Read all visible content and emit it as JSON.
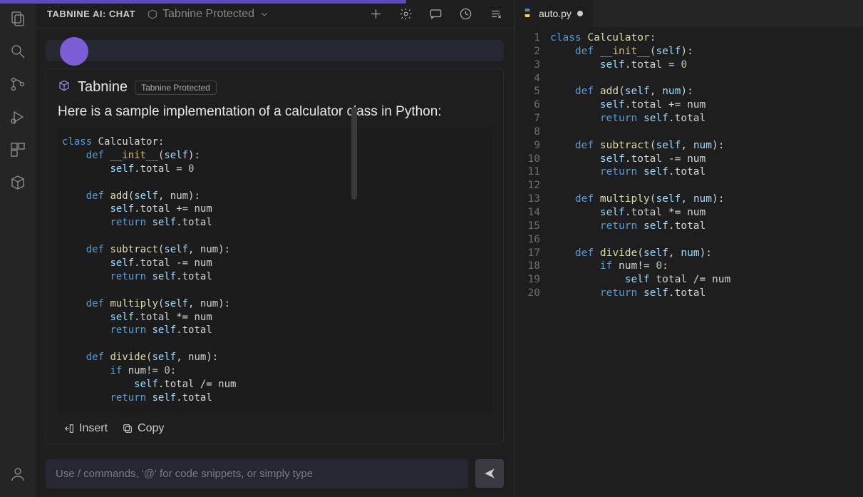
{
  "chat": {
    "title": "TABNINE AI: CHAT",
    "protected_label": "Tabnine Protected",
    "brand": "Tabnine",
    "badge": "Tabnine Protected",
    "intro": "Here is a sample implementation of a calculator class in Python:",
    "code": {
      "lines": [
        [
          {
            "t": "kw",
            "v": "class"
          },
          {
            "t": "",
            "v": " Calculator:"
          }
        ],
        [
          {
            "t": "",
            "v": "    "
          },
          {
            "t": "kw",
            "v": "def"
          },
          {
            "t": "",
            "v": " "
          },
          {
            "t": "magic",
            "v": "__init__"
          },
          {
            "t": "",
            "v": "("
          },
          {
            "t": "self",
            "v": "self"
          },
          {
            "t": "",
            "v": "):"
          }
        ],
        [
          {
            "t": "",
            "v": "        "
          },
          {
            "t": "self",
            "v": "self"
          },
          {
            "t": "",
            "v": ".total = "
          },
          {
            "t": "num",
            "v": "0"
          }
        ],
        [
          {
            "t": "",
            "v": ""
          }
        ],
        [
          {
            "t": "",
            "v": "    "
          },
          {
            "t": "kw",
            "v": "def"
          },
          {
            "t": "",
            "v": " "
          },
          {
            "t": "fn",
            "v": "add"
          },
          {
            "t": "",
            "v": "("
          },
          {
            "t": "self",
            "v": "self"
          },
          {
            "t": "",
            "v": ", num):"
          }
        ],
        [
          {
            "t": "",
            "v": "        "
          },
          {
            "t": "self",
            "v": "self"
          },
          {
            "t": "",
            "v": ".total += num"
          }
        ],
        [
          {
            "t": "",
            "v": "        "
          },
          {
            "t": "kw",
            "v": "return"
          },
          {
            "t": "",
            "v": " "
          },
          {
            "t": "self",
            "v": "self"
          },
          {
            "t": "",
            "v": ".total"
          }
        ],
        [
          {
            "t": "",
            "v": ""
          }
        ],
        [
          {
            "t": "",
            "v": "    "
          },
          {
            "t": "kw",
            "v": "def"
          },
          {
            "t": "",
            "v": " "
          },
          {
            "t": "fn",
            "v": "subtract"
          },
          {
            "t": "",
            "v": "("
          },
          {
            "t": "self",
            "v": "self"
          },
          {
            "t": "",
            "v": ", num):"
          }
        ],
        [
          {
            "t": "",
            "v": "        "
          },
          {
            "t": "self",
            "v": "self"
          },
          {
            "t": "",
            "v": ".total -= num"
          }
        ],
        [
          {
            "t": "",
            "v": "        "
          },
          {
            "t": "kw",
            "v": "return"
          },
          {
            "t": "",
            "v": " "
          },
          {
            "t": "self",
            "v": "self"
          },
          {
            "t": "",
            "v": ".total"
          }
        ],
        [
          {
            "t": "",
            "v": ""
          }
        ],
        [
          {
            "t": "",
            "v": "    "
          },
          {
            "t": "kw",
            "v": "def"
          },
          {
            "t": "",
            "v": " "
          },
          {
            "t": "fn",
            "v": "multiply"
          },
          {
            "t": "",
            "v": "("
          },
          {
            "t": "self",
            "v": "self"
          },
          {
            "t": "",
            "v": ", num):"
          }
        ],
        [
          {
            "t": "",
            "v": "        "
          },
          {
            "t": "self",
            "v": "self"
          },
          {
            "t": "",
            "v": ".total *= num"
          }
        ],
        [
          {
            "t": "",
            "v": "        "
          },
          {
            "t": "kw",
            "v": "return"
          },
          {
            "t": "",
            "v": " "
          },
          {
            "t": "self",
            "v": "self"
          },
          {
            "t": "",
            "v": ".total"
          }
        ],
        [
          {
            "t": "",
            "v": ""
          }
        ],
        [
          {
            "t": "",
            "v": "    "
          },
          {
            "t": "kw",
            "v": "def"
          },
          {
            "t": "",
            "v": " "
          },
          {
            "t": "fn",
            "v": "divide"
          },
          {
            "t": "",
            "v": "("
          },
          {
            "t": "self",
            "v": "self"
          },
          {
            "t": "",
            "v": ", num):"
          }
        ],
        [
          {
            "t": "",
            "v": "        "
          },
          {
            "t": "kw",
            "v": "if"
          },
          {
            "t": "",
            "v": " num!= "
          },
          {
            "t": "num",
            "v": "0"
          },
          {
            "t": "",
            "v": ":"
          }
        ],
        [
          {
            "t": "",
            "v": "            "
          },
          {
            "t": "self",
            "v": "self"
          },
          {
            "t": "",
            "v": ".total /= num"
          }
        ],
        [
          {
            "t": "",
            "v": "        "
          },
          {
            "t": "kw",
            "v": "return"
          },
          {
            "t": "",
            "v": " "
          },
          {
            "t": "self",
            "v": "self"
          },
          {
            "t": "",
            "v": ".total"
          }
        ]
      ]
    },
    "actions": {
      "insert": "Insert",
      "copy": "Copy"
    },
    "placeholder": "Use / commands, '@' for code snippets, or simply type"
  },
  "editor": {
    "tab_name": "auto.py",
    "line_count": 20,
    "code_lines": [
      [
        {
          "t": "kw",
          "v": "class"
        },
        {
          "t": "",
          "v": " "
        },
        {
          "t": "fn",
          "v": "Calculator"
        },
        {
          "t": "",
          "v": ":"
        }
      ],
      [
        {
          "t": "",
          "v": "    "
        },
        {
          "t": "kw",
          "v": "def"
        },
        {
          "t": "",
          "v": " "
        },
        {
          "t": "magic",
          "v": "__init__"
        },
        {
          "t": "",
          "v": "("
        },
        {
          "t": "self",
          "v": "self"
        },
        {
          "t": "",
          "v": "):"
        }
      ],
      [
        {
          "t": "",
          "v": "        "
        },
        {
          "t": "self",
          "v": "self"
        },
        {
          "t": "",
          "v": ".total = "
        },
        {
          "t": "num",
          "v": "0"
        }
      ],
      [
        {
          "t": "",
          "v": ""
        }
      ],
      [
        {
          "t": "",
          "v": "    "
        },
        {
          "t": "kw",
          "v": "def"
        },
        {
          "t": "",
          "v": " "
        },
        {
          "t": "fn",
          "v": "add"
        },
        {
          "t": "",
          "v": "("
        },
        {
          "t": "self",
          "v": "self"
        },
        {
          "t": "",
          "v": ", "
        },
        {
          "t": "self",
          "v": "num"
        },
        {
          "t": "",
          "v": "):"
        }
      ],
      [
        {
          "t": "",
          "v": "        "
        },
        {
          "t": "self",
          "v": "self"
        },
        {
          "t": "",
          "v": ".total += num"
        }
      ],
      [
        {
          "t": "",
          "v": "        "
        },
        {
          "t": "kw",
          "v": "return"
        },
        {
          "t": "",
          "v": " "
        },
        {
          "t": "self",
          "v": "self"
        },
        {
          "t": "",
          "v": ".total"
        }
      ],
      [
        {
          "t": "",
          "v": ""
        }
      ],
      [
        {
          "t": "",
          "v": "    "
        },
        {
          "t": "kw",
          "v": "def"
        },
        {
          "t": "",
          "v": " "
        },
        {
          "t": "fn",
          "v": "subtract"
        },
        {
          "t": "",
          "v": "("
        },
        {
          "t": "self",
          "v": "self"
        },
        {
          "t": "",
          "v": ", "
        },
        {
          "t": "self",
          "v": "num"
        },
        {
          "t": "",
          "v": "):"
        }
      ],
      [
        {
          "t": "",
          "v": "        "
        },
        {
          "t": "self",
          "v": "self"
        },
        {
          "t": "",
          "v": ".total -= num"
        }
      ],
      [
        {
          "t": "",
          "v": "        "
        },
        {
          "t": "kw",
          "v": "return"
        },
        {
          "t": "",
          "v": " "
        },
        {
          "t": "self",
          "v": "self"
        },
        {
          "t": "",
          "v": ".total"
        }
      ],
      [
        {
          "t": "",
          "v": ""
        }
      ],
      [
        {
          "t": "",
          "v": "    "
        },
        {
          "t": "kw",
          "v": "def"
        },
        {
          "t": "",
          "v": " "
        },
        {
          "t": "fn",
          "v": "multiply"
        },
        {
          "t": "",
          "v": "("
        },
        {
          "t": "self",
          "v": "self"
        },
        {
          "t": "",
          "v": ", "
        },
        {
          "t": "self",
          "v": "num"
        },
        {
          "t": "",
          "v": "):"
        }
      ],
      [
        {
          "t": "",
          "v": "        "
        },
        {
          "t": "self",
          "v": "self"
        },
        {
          "t": "",
          "v": ".total *= num"
        }
      ],
      [
        {
          "t": "",
          "v": "        "
        },
        {
          "t": "kw",
          "v": "return"
        },
        {
          "t": "",
          "v": " "
        },
        {
          "t": "self",
          "v": "self"
        },
        {
          "t": "",
          "v": ".total"
        }
      ],
      [
        {
          "t": "",
          "v": ""
        }
      ],
      [
        {
          "t": "",
          "v": "    "
        },
        {
          "t": "kw",
          "v": "def"
        },
        {
          "t": "",
          "v": " "
        },
        {
          "t": "fn",
          "v": "divide"
        },
        {
          "t": "",
          "v": "("
        },
        {
          "t": "self",
          "v": "self"
        },
        {
          "t": "",
          "v": ", "
        },
        {
          "t": "self",
          "v": "num"
        },
        {
          "t": "",
          "v": "):"
        }
      ],
      [
        {
          "t": "",
          "v": "        "
        },
        {
          "t": "kw",
          "v": "if"
        },
        {
          "t": "",
          "v": " num!= "
        },
        {
          "t": "num",
          "v": "0"
        },
        {
          "t": "",
          "v": ":"
        }
      ],
      [
        {
          "t": "",
          "v": "            "
        },
        {
          "t": "self",
          "v": "self"
        },
        {
          "t": "",
          "v": " total /= num"
        }
      ],
      [
        {
          "t": "",
          "v": "        "
        },
        {
          "t": "kw",
          "v": "return"
        },
        {
          "t": "",
          "v": " "
        },
        {
          "t": "self",
          "v": "self"
        },
        {
          "t": "",
          "v": ".total"
        }
      ]
    ]
  }
}
